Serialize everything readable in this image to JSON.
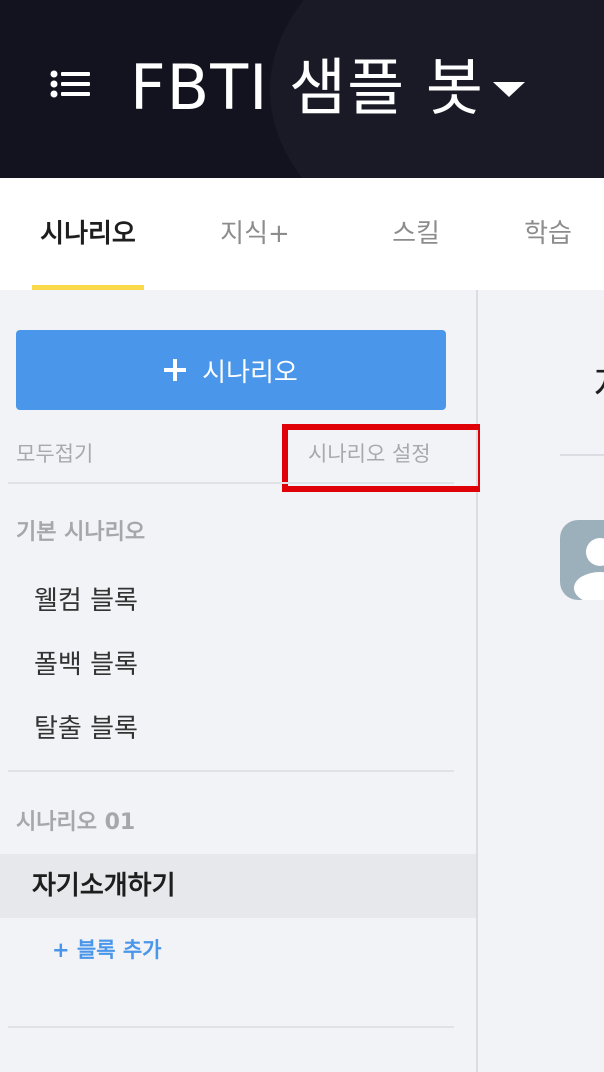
{
  "header": {
    "title": "FBTI 샘플 봇",
    "menu_icon": "hamburger-menu-icon",
    "dropdown_icon": "caret-down-icon",
    "bg_color": "#13131f"
  },
  "tabs": [
    {
      "label": "시나리오",
      "active": true
    },
    {
      "label": "지식+",
      "active": false
    },
    {
      "label": "스킬",
      "active": false
    },
    {
      "label": "학습",
      "active": false
    }
  ],
  "sidebar": {
    "add_button_label": "시나리오",
    "add_button_color": "#4a96ea",
    "collapse_all": "모두접기",
    "scenario_settings": "시나리오 설정",
    "groups": [
      {
        "title": "기본 시나리오",
        "items": [
          "웰컴 블록",
          "폴백 블록",
          "탈출 블록"
        ]
      },
      {
        "title": "시나리오 01",
        "items": [
          "자기소개하기"
        ],
        "add_block": "+ 블록 추가"
      }
    ]
  },
  "main": {
    "partial_title": "자"
  },
  "accent": {
    "tab_underline": "#fbd94a",
    "highlight": "#e00008"
  }
}
